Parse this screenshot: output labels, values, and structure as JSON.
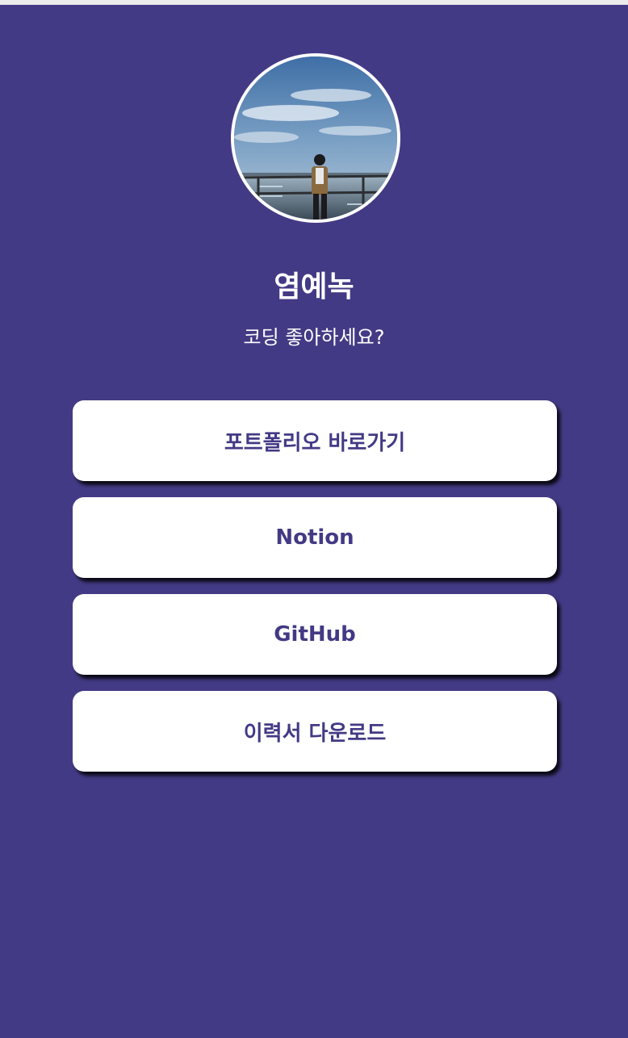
{
  "profile": {
    "name": "염예녹",
    "tagline": "코딩 좋아하세요?"
  },
  "links": [
    {
      "label": "포트폴리오 바로가기"
    },
    {
      "label": "Notion"
    },
    {
      "label": "GitHub"
    },
    {
      "label": "이력서 다운로드"
    }
  ],
  "colors": {
    "background": "#433a85",
    "button_bg": "#ffffff",
    "button_text": "#433a85",
    "text": "#ffffff"
  }
}
